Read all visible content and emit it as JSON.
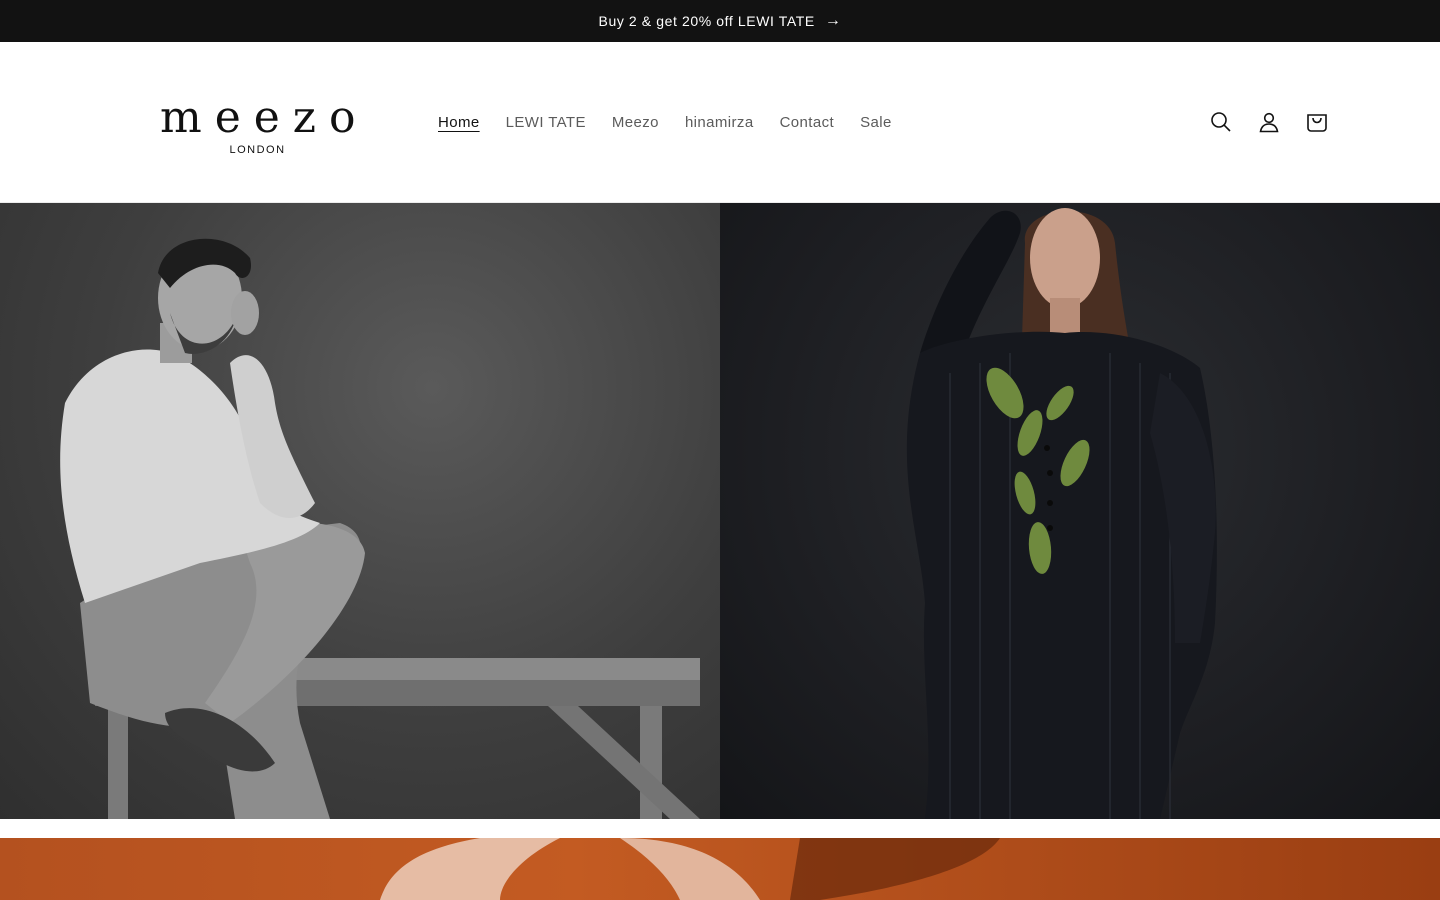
{
  "announcement": {
    "text": "Buy 2 & get 20% off LEWI TATE",
    "arrow": "→"
  },
  "brand": {
    "name": "meezo",
    "subtitle": "LONDON"
  },
  "nav": {
    "items": [
      {
        "label": "Home",
        "active": true
      },
      {
        "label": "LEWI TATE",
        "active": false
      },
      {
        "label": "Meezo",
        "active": false
      },
      {
        "label": "hinamirza",
        "active": false
      },
      {
        "label": "Contact",
        "active": false
      },
      {
        "label": "Sale",
        "active": false
      }
    ]
  },
  "header_icons": [
    "search-icon",
    "account-icon",
    "cart-icon"
  ],
  "hero": {
    "left_image": "man in white shirt seated on bench, monochrome",
    "right_image": "woman in dark striped kurta with green leaf embroidery"
  },
  "colors": {
    "announcement_bg": "#121212",
    "promo_bg": "#b4511f"
  }
}
